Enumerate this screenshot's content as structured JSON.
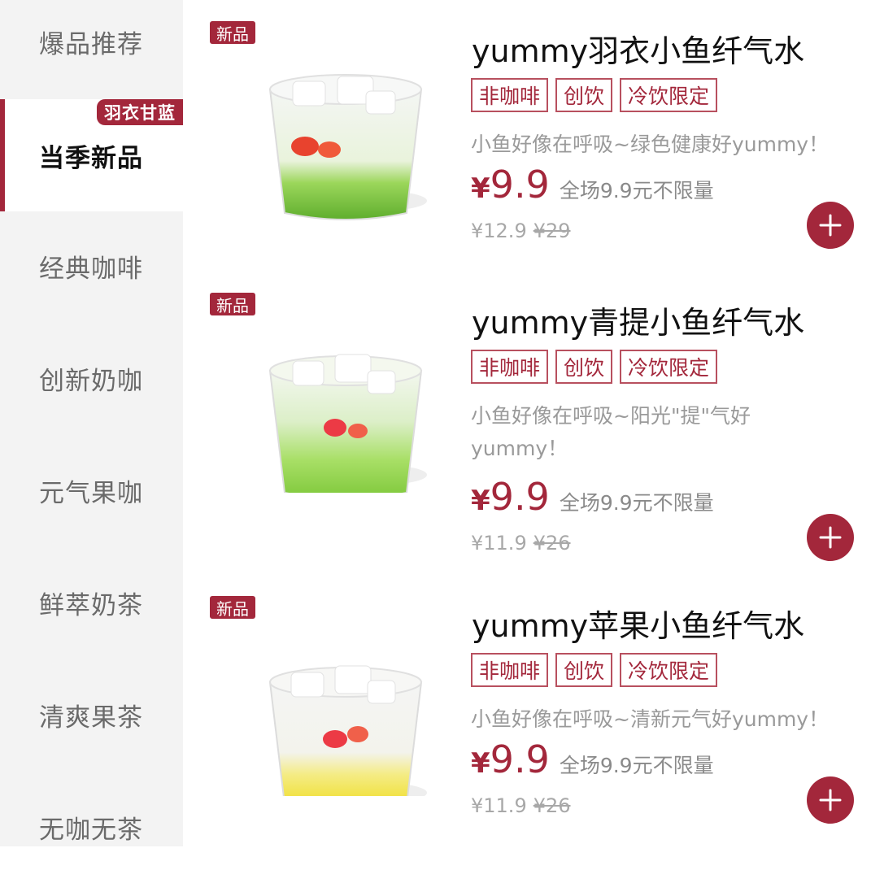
{
  "colors": {
    "accent": "#a3273b",
    "sidebar_bg": "#f3f3f3"
  },
  "sidebar": {
    "items": [
      {
        "label": "爆品推荐"
      },
      {
        "label": "当季新品",
        "active": true,
        "badge": "羽衣甘蓝"
      },
      {
        "label": "经典咖啡"
      },
      {
        "label": "创新奶咖"
      },
      {
        "label": "元气果咖"
      },
      {
        "label": "鲜萃奶茶"
      },
      {
        "label": "清爽果茶"
      },
      {
        "label": "无咖无茶"
      }
    ]
  },
  "products": [
    {
      "badge": "新品",
      "name": "yummy羽衣小鱼纤气水",
      "tags": [
        "非咖啡",
        "创饮",
        "冷饮限定"
      ],
      "description": "小鱼好像在呼吸~绿色健康好yummy！",
      "price_symbol": "¥",
      "price": "9.9",
      "promo": "全场9.9元不限量",
      "member_price": "¥12.9",
      "original_price": "¥29",
      "drink_color": "green",
      "add_icon": "plus-icon"
    },
    {
      "badge": "新品",
      "name": "yummy青提小鱼纤气水",
      "tags": [
        "非咖啡",
        "创饮",
        "冷饮限定"
      ],
      "description": "小鱼好像在呼吸~阳光\"提\"气好yummy！",
      "price_symbol": "¥",
      "price": "9.9",
      "promo": "全场9.9元不限量",
      "member_price": "¥11.9",
      "original_price": "¥26",
      "drink_color": "light-green",
      "add_icon": "plus-icon"
    },
    {
      "badge": "新品",
      "name": "yummy苹果小鱼纤气水",
      "tags": [
        "非咖啡",
        "创饮",
        "冷饮限定"
      ],
      "description": "小鱼好像在呼吸~清新元气好yummy！",
      "price_symbol": "¥",
      "price": "9.9",
      "promo": "全场9.9元不限量",
      "member_price": "¥11.9",
      "original_price": "¥26",
      "drink_color": "yellow",
      "add_icon": "plus-icon"
    }
  ]
}
